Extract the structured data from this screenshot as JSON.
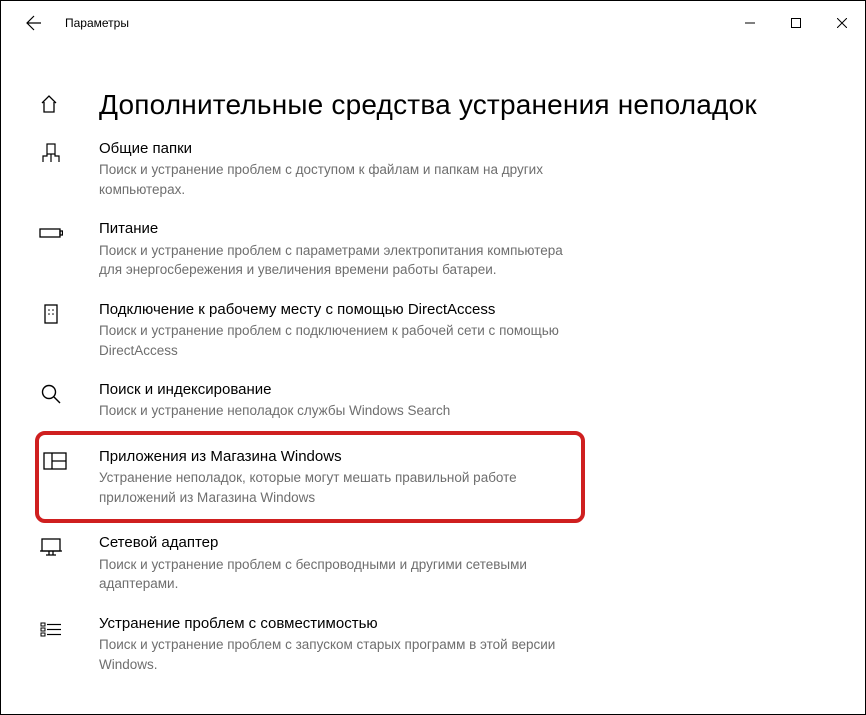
{
  "window": {
    "title": "Параметры"
  },
  "page": {
    "heading": "Дополнительные средства устранения неполадок"
  },
  "troubleshooters": [
    {
      "icon": "shared-folders-icon",
      "title": "Общие папки",
      "desc": "Поиск и устранение проблем с доступом к файлам и папкам на других компьютерах."
    },
    {
      "icon": "power-icon",
      "title": "Питание",
      "desc": "Поиск и устранение проблем с параметрами электропитания компьютера для энергосбережения и увеличения  времени работы батареи."
    },
    {
      "icon": "directaccess-icon",
      "title": "Подключение к рабочему месту с помощью DirectAccess",
      "desc": "Поиск и устранение проблем с подключением к рабочей сети с помощью DirectAccess"
    },
    {
      "icon": "search-index-icon",
      "title": "Поиск и индексирование",
      "desc": "Поиск и устранение неполадок службы Windows Search"
    },
    {
      "icon": "store-apps-icon",
      "title": "Приложения из Магазина Windows",
      "desc": "Устранение неполадок, которые могут мешать правильной работе приложений из Магазина Windows"
    },
    {
      "icon": "network-adapter-icon",
      "title": "Сетевой адаптер",
      "desc": "Поиск и устранение проблем с беспроводными и другими сетевыми адаптерами."
    },
    {
      "icon": "compatibility-icon",
      "title": "Устранение проблем с совместимостью",
      "desc": "Поиск и устранение проблем с запуском старых программ в этой версии Windows."
    }
  ]
}
